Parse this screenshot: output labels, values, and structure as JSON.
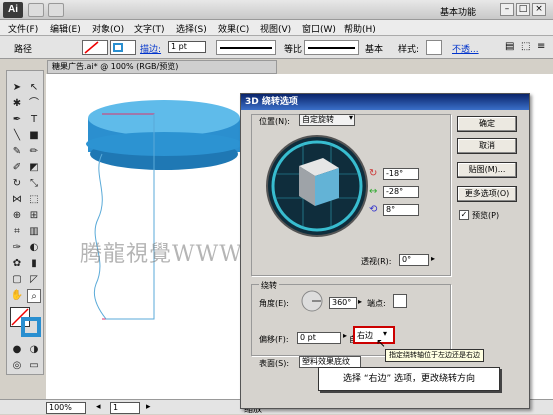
{
  "app": {
    "logo": "Ai",
    "workspace": "基本功能",
    "win_min": "–",
    "win_max": "□",
    "win_close": "×"
  },
  "menu": [
    "文件(F)",
    "编辑(E)",
    "对象(O)",
    "文字(T)",
    "选择(S)",
    "效果(C)",
    "视图(V)",
    "窗口(W)",
    "帮助(H)"
  ],
  "control": {
    "path_label": "路径",
    "stroke_label": "描边:",
    "stroke_value": "1 pt",
    "brush1": "等比",
    "brush2": "基本",
    "style_label": "样式:",
    "opacity_link": "不透..."
  },
  "document": {
    "tab": "糖果广告.ai* @ 100% (RGB/预览)",
    "zoom": "100%",
    "page": "1",
    "status": "缩放"
  },
  "watermark": "腾龍視覺WWW.TLVI.NET",
  "dialog": {
    "title": "3D 绕转选项",
    "position_label": "位置(N):",
    "position_value": "自定旋转",
    "rot_x": "-18°",
    "rot_y": "-28°",
    "rot_z": "8°",
    "perspective_label": "透视(R):",
    "perspective_value": "0°",
    "revolve_label": "绕转",
    "angle_label": "角度(E):",
    "angle_value": "360°",
    "cap_label": "端点:",
    "offset_label": "偏移(F):",
    "offset_value": "0 pt",
    "from_label": "自",
    "edge_value": "右边",
    "surface_label": "表面(S):",
    "surface_value": "塑料效果底纹",
    "ok": "确定",
    "cancel": "取消",
    "map": "贴图(M)...",
    "more": "更多选项(O)",
    "preview": "预览(P)"
  },
  "tooltip": "指定绕转轴位于左边还是右边",
  "callout": "选择 “右边” 选项，更改绕转方向",
  "colors": {
    "accent": "#2a8fd0",
    "highlight_box": "#cc0000",
    "title_bar": "#0a246a"
  }
}
